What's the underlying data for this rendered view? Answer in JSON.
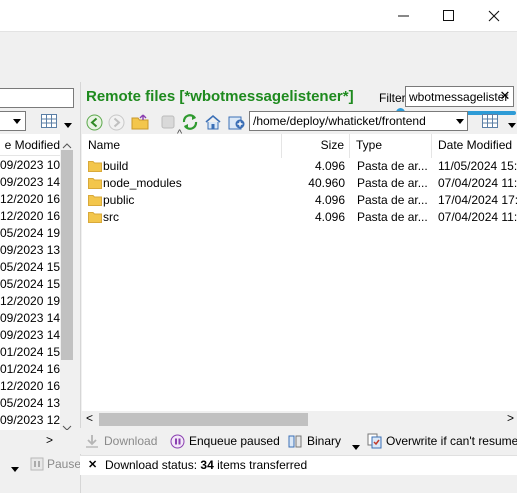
{
  "window": {
    "minimize_glyph": "—",
    "maximize_glyph": "☐",
    "close_glyph": "✕"
  },
  "local": {
    "column_header": "e Modified",
    "rows": [
      "09/2023 10",
      "09/2023 14",
      "12/2020 16",
      "12/2020 16",
      "05/2024 19",
      "09/2023 13",
      "05/2024 15",
      "05/2024 15",
      "12/2020 19",
      "09/2023 14",
      "09/2023 14",
      "01/2024 15",
      "01/2024 16",
      "12/2020 16",
      "05/2024 13",
      "09/2023 12"
    ],
    "bottom_arrow": ">",
    "pause_label": "Pause"
  },
  "remote": {
    "title": "Remote files [*wbotmessagelistener*]",
    "filter_label": "Filter:",
    "filter_value": "wbotmessagelister",
    "filter_clear": "✕",
    "path": "/home/deploy/whaticket/frontend",
    "columns": {
      "name": "Name",
      "size": "Size",
      "type": "Type",
      "date": "Date Modified"
    },
    "sort_indicator": "^",
    "files": [
      {
        "name": "build",
        "size": "4.096",
        "type": "Pasta de ar...",
        "date": "11/05/2024 15:..."
      },
      {
        "name": "node_modules",
        "size": "40.960",
        "type": "Pasta de ar...",
        "date": "07/04/2024 11:..."
      },
      {
        "name": "public",
        "size": "4.096",
        "type": "Pasta de ar...",
        "date": "17/04/2024 17:..."
      },
      {
        "name": "src",
        "size": "4.096",
        "type": "Pasta de ar...",
        "date": "07/04/2024 11:..."
      }
    ],
    "scroll_left": "<",
    "scroll_right": ">"
  },
  "transfer": {
    "download_label": "Download",
    "enqueue_label": "Enqueue paused",
    "binary_label": "Binary",
    "overwrite_label": "Overwrite if can't resume",
    "status_prefix": "Download status:",
    "status_count": "34",
    "status_suffix": "items transferred",
    "status_close": "✕"
  },
  "colors": {
    "remote_title": "#1e8a1e",
    "filter_accent": "#2e9bd6",
    "folder": "#f3c64c"
  }
}
